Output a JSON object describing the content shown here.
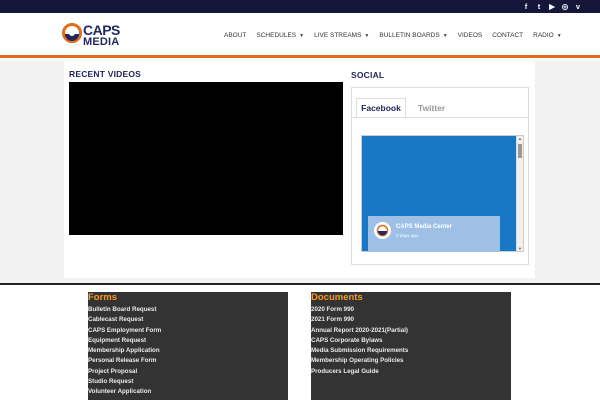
{
  "top_bar": {
    "social_icons": [
      {
        "icon": "facebook-icon",
        "glyph": "f"
      },
      {
        "icon": "twitter-icon",
        "glyph": "t"
      },
      {
        "icon": "youtube-icon",
        "glyph": "▶"
      },
      {
        "icon": "instagram-icon",
        "glyph": "◎"
      },
      {
        "icon": "vimeo-icon",
        "glyph": "v"
      }
    ]
  },
  "header": {
    "logo": {
      "word1": "CAPS",
      "word2": "MEDIA"
    },
    "nav": [
      {
        "label": "ABOUT",
        "has_dropdown": false
      },
      {
        "label": "SCHEDULES",
        "has_dropdown": true
      },
      {
        "label": "LIVE STREAMS",
        "has_dropdown": true
      },
      {
        "label": "BULLETIN BOARDS",
        "has_dropdown": true
      },
      {
        "label": "VIDEOS",
        "has_dropdown": false
      },
      {
        "label": "CONTACT",
        "has_dropdown": false
      },
      {
        "label": "RADIO",
        "has_dropdown": true
      }
    ]
  },
  "recent_videos": {
    "title": "RECENT VIDEOS"
  },
  "social": {
    "title": "SOCIAL",
    "tabs": [
      {
        "label": "Facebook",
        "active": true
      },
      {
        "label": "Twitter",
        "active": false
      }
    ],
    "facebook_widget": {
      "page_name": "CAPS Media Center",
      "time_ago": "2 days ago"
    }
  },
  "footer": {
    "forms": {
      "title": "Forms",
      "items": [
        "Bulletin Board Request",
        "Cablecast Request",
        "CAPS Employment Form",
        "Equipment Request",
        "Membership Application",
        "Personal Release Form",
        "Project Proposal",
        "Studio Request",
        "Volunteer Application"
      ]
    },
    "documents": {
      "title": "Documents",
      "items": [
        "2020 Form 990",
        "2021 Form 990",
        "Annual Report 2020-2021(Partial)",
        "CAPS Corporate Bylaws",
        "Media Submission Requirements",
        "Membership Operating Policies",
        "Producers Legal Guide"
      ]
    }
  },
  "colors": {
    "top_bar": "#14163a",
    "brand_navy": "#23295f",
    "accent_orange": "#e36b1d",
    "footer_heading": "#f39a23",
    "facebook_blue": "#1878c6"
  }
}
